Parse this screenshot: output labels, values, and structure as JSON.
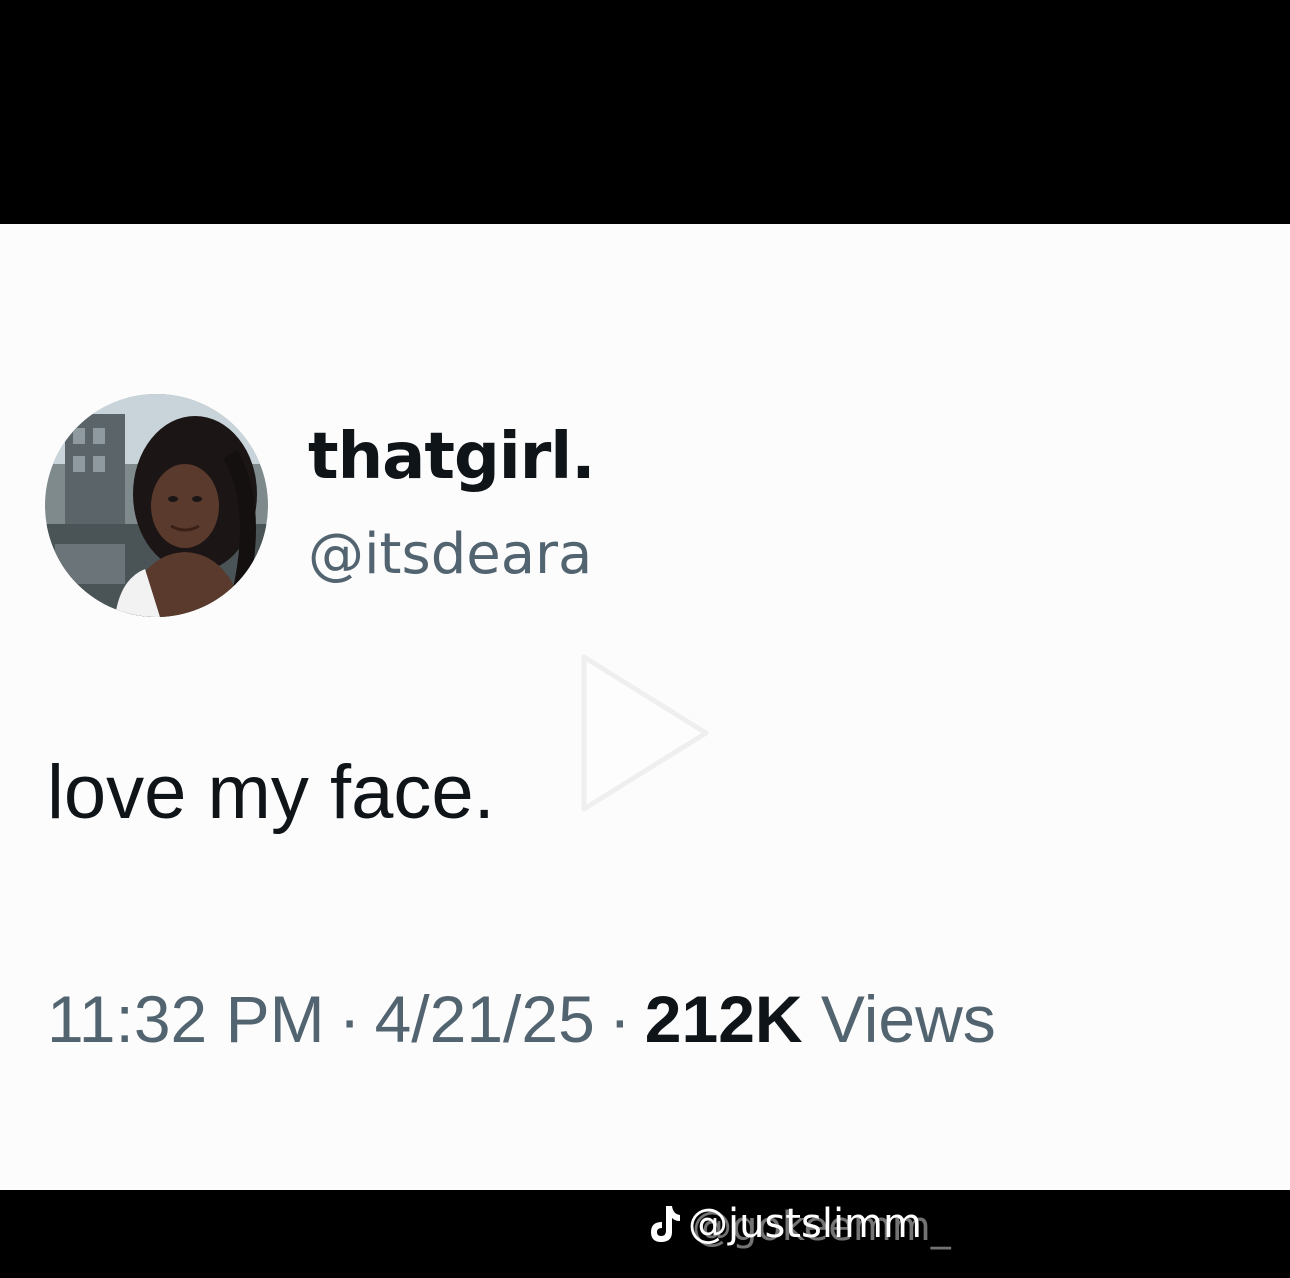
{
  "tweet": {
    "display_name": "thatgirl.",
    "handle": "@itsdeara",
    "text": "love my face.",
    "time": "11:32 PM",
    "separator": "·",
    "date": "4/21/25",
    "views_count": "212K",
    "views_label": "Views"
  },
  "icons": {
    "avatar": "profile-photo",
    "overlay": "play-icon",
    "watermark_logo": "tiktok-icon"
  },
  "watermark": {
    "handle": "@justslimm",
    "handle_overlap": "@gokeemm_"
  },
  "colors": {
    "card_background": "#fcfcfc",
    "primary_text": "#0f1419",
    "secondary_text": "#536471",
    "letterbox": "#000000"
  }
}
